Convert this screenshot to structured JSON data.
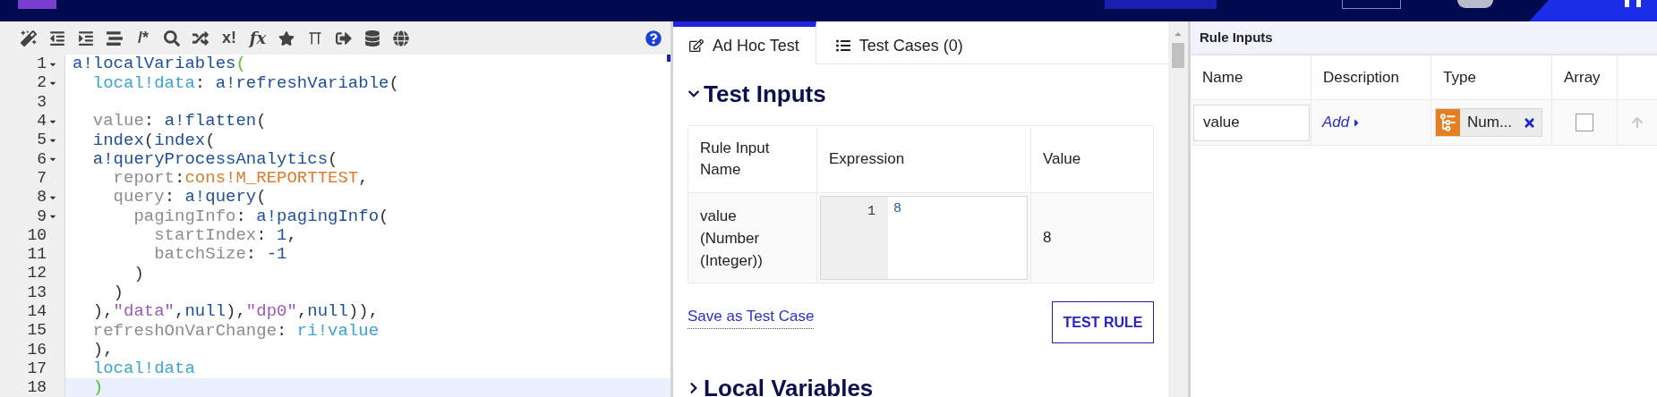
{
  "toolbar": [
    {
      "kind": "icon"
    },
    {
      "kind": "icon"
    },
    {
      "kind": "icon"
    },
    {
      "kind": "icon"
    },
    {
      "kind": "text",
      "label": "/*"
    },
    {
      "kind": "icon"
    },
    {
      "kind": "icon"
    },
    {
      "kind": "text",
      "label": "x!"
    },
    {
      "kind": "text",
      "label": "fx"
    },
    {
      "kind": "icon"
    },
    {
      "kind": "icon"
    },
    {
      "kind": "icon"
    },
    {
      "kind": "icon"
    },
    {
      "kind": "icon"
    }
  ],
  "code_lines": [
    {
      "number": "1",
      "fold": true,
      "active": false,
      "tokens": [
        {
          "kind": "fn",
          "text": "a!localVariables"
        },
        {
          "kind": "match",
          "text": "("
        }
      ]
    },
    {
      "number": "2",
      "fold": true,
      "active": false,
      "tokens": [
        {
          "kind": "var",
          "text": "  local!data"
        },
        {
          "kind": "punct",
          "text": ": "
        },
        {
          "kind": "fn",
          "text": "a!refreshVariable"
        },
        {
          "kind": "punct",
          "text": "("
        }
      ]
    },
    {
      "number": "3",
      "fold": false,
      "active": false
    },
    {
      "number": "4",
      "fold": true,
      "active": false,
      "tokens": [
        {
          "kind": "key",
          "text": "  value"
        },
        {
          "kind": "punct",
          "text": ": "
        },
        {
          "kind": "fn",
          "text": "a!flatten"
        },
        {
          "kind": "punct",
          "text": "("
        }
      ]
    },
    {
      "number": "5",
      "fold": true,
      "active": false,
      "tokens": [
        {
          "kind": "fn",
          "text": "  index"
        },
        {
          "kind": "punct",
          "text": "("
        },
        {
          "kind": "fn",
          "text": "index"
        },
        {
          "kind": "punct",
          "text": "("
        }
      ]
    },
    {
      "number": "6",
      "fold": true,
      "active": false,
      "tokens": [
        {
          "kind": "fn",
          "text": "  a!queryProcessAnalytics"
        },
        {
          "kind": "punct",
          "text": "("
        }
      ]
    },
    {
      "number": "7",
      "fold": false,
      "active": false,
      "tokens": [
        {
          "kind": "key",
          "text": "    report"
        },
        {
          "kind": "punct",
          "text": ":"
        },
        {
          "kind": "const",
          "text": "cons!M_REPORTTEST"
        },
        {
          "kind": "punct",
          "text": ","
        }
      ]
    },
    {
      "number": "8",
      "fold": true,
      "active": false,
      "tokens": [
        {
          "kind": "key",
          "text": "    query"
        },
        {
          "kind": "punct",
          "text": ": "
        },
        {
          "kind": "fn",
          "text": "a!query"
        },
        {
          "kind": "punct",
          "text": "("
        }
      ]
    },
    {
      "number": "9",
      "fold": true,
      "active": false,
      "tokens": [
        {
          "kind": "key",
          "text": "      pagingInfo"
        },
        {
          "kind": "punct",
          "text": ": "
        },
        {
          "kind": "fn",
          "text": "a!pagingInfo"
        },
        {
          "kind": "punct",
          "text": "("
        }
      ]
    },
    {
      "number": "10",
      "fold": false,
      "active": false,
      "tokens": [
        {
          "kind": "key",
          "text": "        startIndex"
        },
        {
          "kind": "punct",
          "text": ": "
        },
        {
          "kind": "fn",
          "text": "1"
        },
        {
          "kind": "punct",
          "text": ","
        }
      ]
    },
    {
      "number": "11",
      "fold": false,
      "active": false,
      "tokens": [
        {
          "kind": "key",
          "text": "        batchSize"
        },
        {
          "kind": "punct",
          "text": ": "
        },
        {
          "kind": "fn",
          "text": "-1"
        }
      ]
    },
    {
      "number": "12",
      "fold": false,
      "active": false,
      "tokens": [
        {
          "kind": "punct",
          "text": "      )"
        }
      ]
    },
    {
      "number": "13",
      "fold": false,
      "active": false,
      "tokens": [
        {
          "kind": "punct",
          "text": "    )"
        }
      ]
    },
    {
      "number": "14",
      "fold": false,
      "active": false,
      "tokens": [
        {
          "kind": "punct",
          "text": "  ),"
        },
        {
          "kind": "str",
          "text": "\"data\""
        },
        {
          "kind": "punct",
          "text": ","
        },
        {
          "kind": "fn",
          "text": "null"
        },
        {
          "kind": "punct",
          "text": "),"
        },
        {
          "kind": "str",
          "text": "\"dp0\""
        },
        {
          "kind": "punct",
          "text": ","
        },
        {
          "kind": "fn",
          "text": "null"
        },
        {
          "kind": "punct",
          "text": ")),"
        }
      ]
    },
    {
      "number": "15",
      "fold": false,
      "active": false,
      "tokens": [
        {
          "kind": "key",
          "text": "  refreshOnVarChange"
        },
        {
          "kind": "punct",
          "text": ": "
        },
        {
          "kind": "var",
          "text": "ri!value"
        }
      ]
    },
    {
      "number": "16",
      "fold": false,
      "active": false,
      "tokens": [
        {
          "kind": "punct",
          "text": "  ),"
        }
      ]
    },
    {
      "number": "17",
      "fold": false,
      "active": false,
      "tokens": [
        {
          "kind": "var",
          "text": "  local!data"
        }
      ]
    },
    {
      "number": "18",
      "fold": false,
      "active": true,
      "tokens": [
        {
          "kind": "match",
          "text": "  )"
        }
      ]
    }
  ],
  "test_panel": {
    "tabs": [
      {
        "label": "Ad Hoc Test",
        "selected": true
      },
      {
        "label": "Test Cases (0)",
        "selected": false
      }
    ],
    "test_inputs": {
      "title": "Test Inputs",
      "expanded": true,
      "columns": [
        "Rule Input Name",
        "Expression",
        "Value"
      ],
      "rows": [
        {
          "name": "value (Number (Integer))",
          "line_number": "1",
          "expression": "8",
          "value": "8"
        }
      ]
    },
    "save_link": "Save as Test Case",
    "test_button": "TEST RULE",
    "local_variables": {
      "title": "Local Variables",
      "expanded": false
    }
  },
  "rule_inputs": {
    "title": "Rule Inputs",
    "columns": [
      "Name",
      "Description",
      "Type",
      "Array"
    ],
    "rows": [
      {
        "name": "value",
        "description_link": "Add",
        "type": "Num...",
        "array": false
      }
    ]
  }
}
